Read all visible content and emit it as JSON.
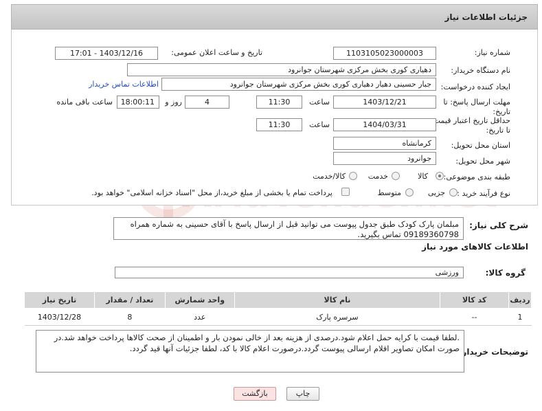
{
  "header": {
    "title": "جزئیات اطلاعات نیاز"
  },
  "fields": {
    "need_number_label": "شماره نیاز:",
    "need_number": "1103105023000003",
    "announce_label": "تاریخ و ساعت اعلان عمومی:",
    "announce_value": "1403/12/16 - 17:01",
    "buyer_org_label": "نام دستگاه خریدار:",
    "buyer_org": "دهیاری کوری بخش مرکزی شهرستان جوانرود",
    "creator_label": "ایجاد کننده درخواست:",
    "creator": "جبار حسینی دهیار دهیاری کوری بخش مرکزی شهرستان جوانرود",
    "contact_link": "اطلاعات تماس خریدار",
    "reply_deadline_label": "مهلت ارسال پاسخ: تا تاریخ:",
    "reply_date": "1403/12/21",
    "time_word": "ساعت",
    "reply_time": "11:30",
    "days_value": "4",
    "days_word": "روز و",
    "remaining_time": "18:00:11",
    "remaining_word": "ساعت باقی مانده",
    "price_validity_label": "حداقل تاریخ اعتبار قیمت: تا تاریخ:",
    "price_date": "1404/03/31",
    "price_time": "11:30",
    "province_label": "استان محل تحویل:",
    "province": "کرمانشاه",
    "city_label": "شهر محل تحویل:",
    "city": "جوانرود",
    "category_label": "طبقه بندی موضوعی:",
    "category_options": [
      "کالا",
      "خدمت",
      "کالا/خدمت"
    ],
    "process_label": "نوع فرآیند خرید :",
    "process_options": [
      "جزیی",
      "متوسط"
    ],
    "payment_note": "پرداخت تمام یا بخشی از مبلغ خرید،از محل \"اسناد خزانه اسلامی\" خواهد بود."
  },
  "description": {
    "label": "شرح کلی نیاز:",
    "text": "مبلمان پارک کودک طبق جدول پیوست می توانید قبل از ارسال پاسخ با آقای حسینی به شماره همراه 09189360798 تماس بگیرید."
  },
  "goods_section": {
    "title": "اطلاعات کالاهای مورد نیاز",
    "group_label": "گروه کالا:",
    "group_value": "ورزشی"
  },
  "table": {
    "headers": [
      "ردیف",
      "کد کالا",
      "نام کالا",
      "واحد شمارش",
      "تعداد / مقدار",
      "تاریخ نیاز"
    ],
    "rows": [
      [
        "1",
        "--",
        "سرسره پارک",
        "عدد",
        "8",
        "1403/12/28"
      ]
    ]
  },
  "buyer_notes": {
    "label": "توضیحات خریدار:",
    "text": ".لطفا قیمت با کرایه حمل اعلام شود.درصدی از هزینه بعد از خالی نمودن بار و اطمینان از صحت کالاها پرداخت خواهد شد.در صورت امکان تصاویر اقلام ارسالی پیوست گردد.درصورت اعلام کالا با کد، لطفا جزئیات آنها قید گردد."
  },
  "buttons": {
    "print": "چاپ",
    "back": "بازگشت"
  },
  "watermark": {
    "text": "AriaTender.net"
  },
  "colors": {
    "link": "#1f4fbf",
    "header_bg": "#cfcfcf",
    "back_button": "#fbe3e3"
  }
}
